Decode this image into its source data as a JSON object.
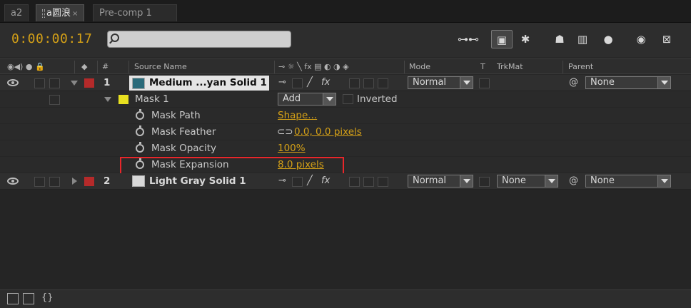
{
  "tabs": [
    {
      "label": "a2"
    },
    {
      "label": "a圆浪",
      "close": "×"
    },
    {
      "label": "Pre-comp 1"
    }
  ],
  "timecode": "0:00:00:17",
  "search": {
    "value": "",
    "placeholder": ""
  },
  "columns": {
    "num": "#",
    "source_name": "Source Name",
    "mode": "Mode",
    "t": "T",
    "trkmat": "TrkMat",
    "parent": "Parent"
  },
  "layers": [
    {
      "index": "1",
      "name": "Medium ...yan Solid 1",
      "swatch_color": "#2a6b7a",
      "label_color": "#b52a2a",
      "mode": "Normal",
      "parent": "None",
      "mask": {
        "name": "Mask 1",
        "mode": "Add",
        "inverted_label": "Inverted",
        "label_color": "#e8e020",
        "properties": [
          {
            "name": "Mask Path",
            "value": "Shape..."
          },
          {
            "name": "Mask Feather",
            "value": "0.0, 0.0 pixels"
          },
          {
            "name": "Mask Opacity",
            "value": "100%"
          },
          {
            "name": "Mask Expansion",
            "value": "8.0 pixels"
          }
        ]
      }
    },
    {
      "index": "2",
      "name": "Light Gray Solid 1",
      "swatch_color": "#d8d8d8",
      "label_color": "#b52a2a",
      "mode": "Normal",
      "trkmat": "None",
      "parent": "None"
    }
  ],
  "highlight_color": "#e8262a",
  "timecode_color": "#d4a017"
}
